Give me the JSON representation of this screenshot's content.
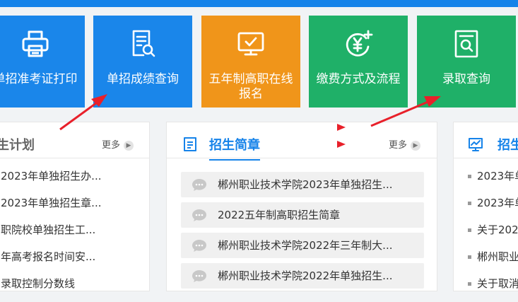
{
  "tiles": [
    {
      "label": "单招准考证打印",
      "icon": "printer-icon",
      "color": "#1a86ea"
    },
    {
      "label": "单招成绩查询",
      "icon": "document-search-icon",
      "color": "#1a86ea"
    },
    {
      "label": "五年制高职在线报名",
      "icon": "monitor-check-icon",
      "color": "#f0951a"
    },
    {
      "label": "缴费方式及流程",
      "icon": "yuan-coin-icon",
      "color": "#1fb068"
    },
    {
      "label": "录取查询",
      "icon": "document-search-icon",
      "color": "#1fb068"
    }
  ],
  "panels": {
    "plan": {
      "title": "生计划",
      "more": "更多",
      "items": [
        "2023年单独招生办...",
        "2023年单独招生章...",
        "职院校单独招生工...",
        "年高考报名时间安...",
        "录取控制分数线"
      ]
    },
    "brochure": {
      "title": "招生简章",
      "more": "更多",
      "items": [
        "郴州职业技术学院2023年单独招生...",
        "2022五年制高职招生简章",
        "郴州职业技术学院2022年三年制大...",
        "郴州职业技术学院2022年单独招生..."
      ]
    },
    "third": {
      "title": "招生",
      "items": [
        "2023年单",
        "2023年单",
        "关于2022",
        "郴州职业",
        "关于取消"
      ]
    }
  },
  "colors": {
    "blue": "#1683e9",
    "orange": "#f0951a",
    "green": "#1fb068",
    "arrow": "#e8202a"
  }
}
